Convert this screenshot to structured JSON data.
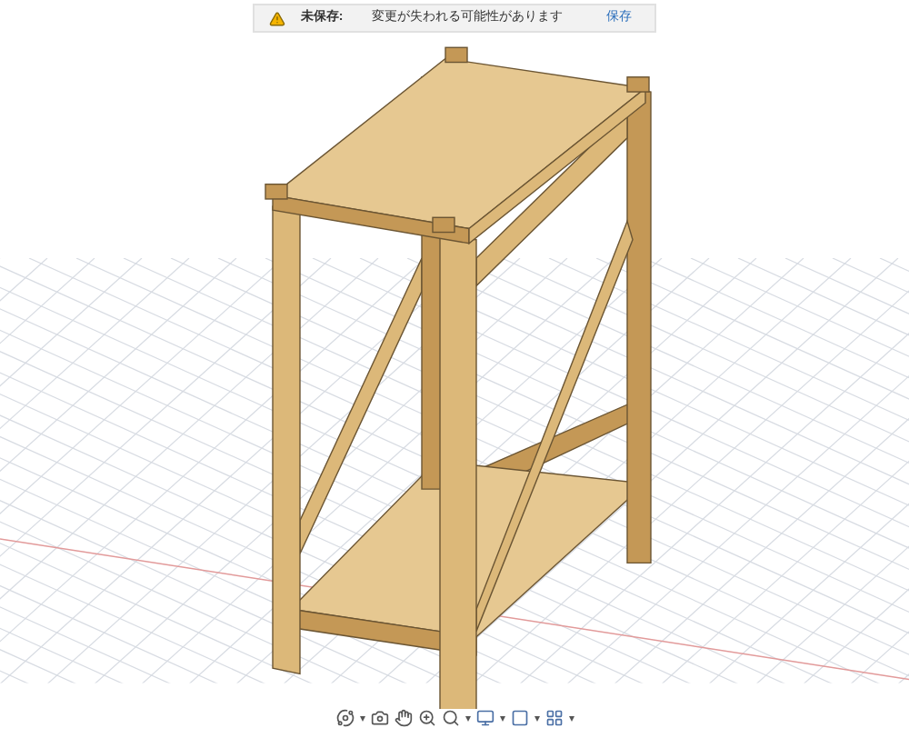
{
  "notification": {
    "status_label": "未保存:",
    "message": "変更が失われる可能性があります",
    "action": "保存"
  }
}
